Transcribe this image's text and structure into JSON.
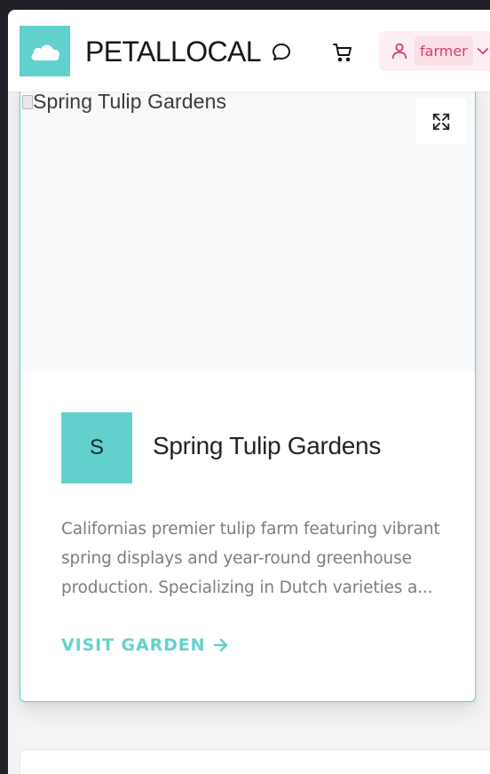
{
  "header": {
    "brand": "PETALLOCAL",
    "user": {
      "name": "farmer"
    }
  },
  "garden_card": {
    "image_alt": "Spring Tulip Gardens",
    "avatar_letter": "S",
    "name": "Spring Tulip Gardens",
    "description": "Californias premier tulip farm featuring vibrant spring displays and year-round greenhouse production. Specializing in Dutch varieties a...",
    "visit_label": "VISIT GARDEN"
  },
  "icons": {
    "logo": "cloud-icon",
    "messages": "chat-bubble-icon",
    "cart": "shopping-cart-icon",
    "user": "user-icon",
    "user_menu_toggle": "chevron-down-icon",
    "expand": "expand-icon",
    "visit_arrow": "arrow-right-icon"
  },
  "colors": {
    "accent": "#63d2cd",
    "user_pill_bg": "#fdeef2",
    "user_pill_text": "#d63f6d",
    "text_primary": "#1f2427",
    "text_muted": "#7a7e82"
  }
}
